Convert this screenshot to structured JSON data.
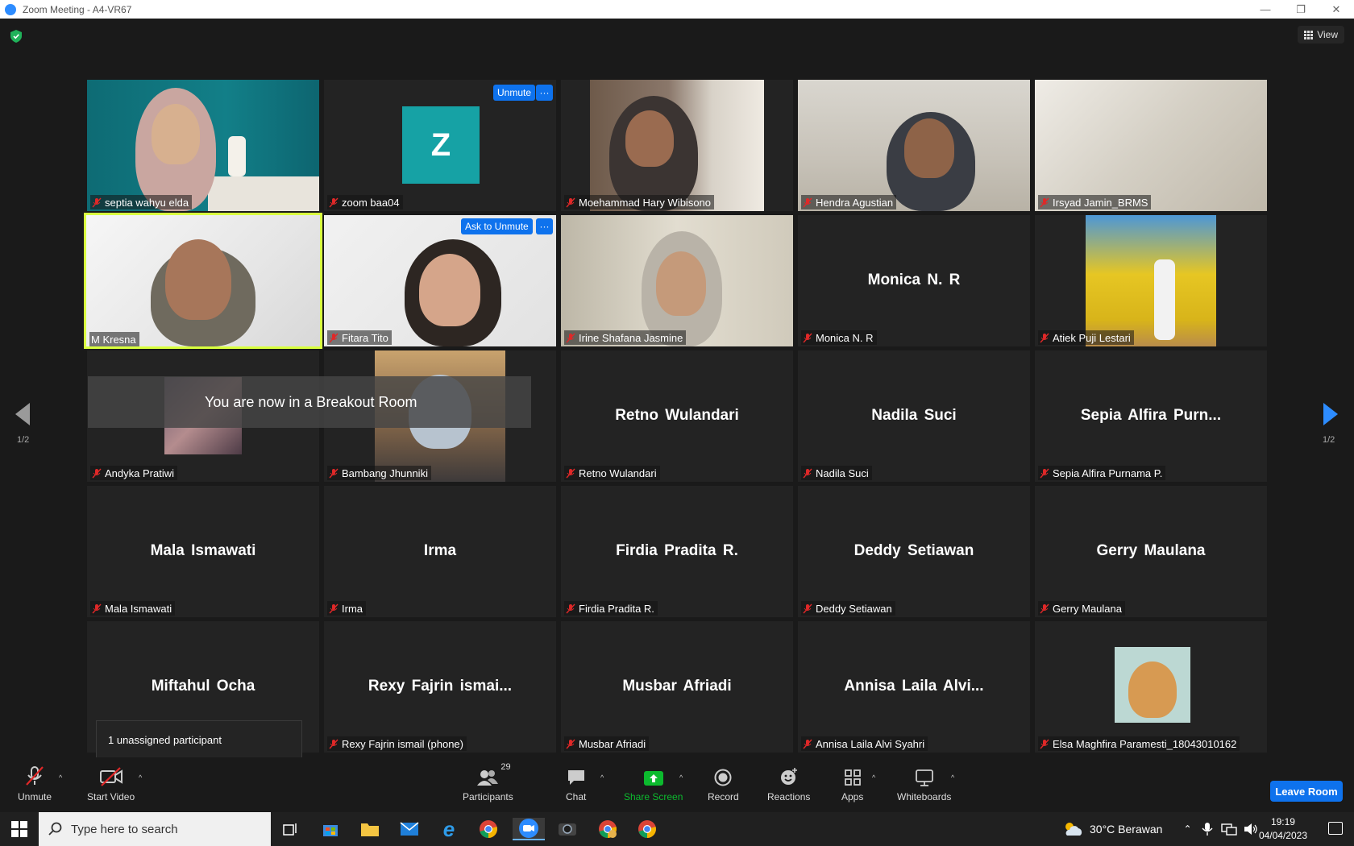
{
  "window": {
    "title": "Zoom Meeting - A4-VR67",
    "minimize": "—",
    "restore": "❐",
    "close": "✕"
  },
  "view": {
    "label": "View"
  },
  "pagination": {
    "left": "1/2",
    "right": "1/2"
  },
  "tiles": [
    {
      "name": "septia wahyu elda",
      "big": ""
    },
    {
      "name": "zoom baa04",
      "big": "",
      "avatar_letter": "Z",
      "tag": "Unmute",
      "more": "···"
    },
    {
      "name": "Moehammad Hary Wibisono",
      "big": ""
    },
    {
      "name": "Hendra Agustian",
      "big": ""
    },
    {
      "name": "Irsyad Jamin_BRMS",
      "big": ""
    },
    {
      "name": "M Kresna",
      "big": ""
    },
    {
      "name": "Fitara Tito",
      "big": "",
      "tag": "Ask to Unmute",
      "more": "···"
    },
    {
      "name": "Irine Shafana Jasmine",
      "big": ""
    },
    {
      "name": "Monica N. R",
      "big": "Monica N. R"
    },
    {
      "name": "Atiek Puji Lestari",
      "big": ""
    },
    {
      "name": "Andyka Pratiwi",
      "big": ""
    },
    {
      "name": "Bambang Jhunniki",
      "big": ""
    },
    {
      "name": "Retno Wulandari",
      "big": "Retno Wulandari"
    },
    {
      "name": "Nadila Suci",
      "big": "Nadila Suci"
    },
    {
      "name": "Sepia Alfira Purnama P.",
      "big": "Sepia Alfira Purn..."
    },
    {
      "name": "Mala Ismawati",
      "big": "Mala Ismawati"
    },
    {
      "name": "Irma",
      "big": "Irma"
    },
    {
      "name": "Firdia Pradita R.",
      "big": "Firdia Pradita R."
    },
    {
      "name": "Deddy Setiawan",
      "big": "Deddy Setiawan"
    },
    {
      "name": "Gerry Maulana",
      "big": "Gerry Maulana"
    },
    {
      "name": "",
      "big": "Miftahul Ocha"
    },
    {
      "name": "Rexy Fajrin ismail (phone)",
      "big": "Rexy Fajrin ismai..."
    },
    {
      "name": "Musbar Afriadi",
      "big": "Musbar Afriadi"
    },
    {
      "name": "Annisa Laila Alvi Syahri",
      "big": "Annisa Laila Alvi..."
    },
    {
      "name": "Elsa Maghfira Paramesti_18043010162",
      "big": ""
    }
  ],
  "breakout_notice": "You are now in a Breakout Room",
  "unassigned_tooltip": "1 unassigned participant",
  "toolbar": {
    "unmute": "Unmute",
    "start_video": "Start Video",
    "participants": "Participants",
    "participants_count": "29",
    "chat": "Chat",
    "share_screen": "Share Screen",
    "record": "Record",
    "reactions": "Reactions",
    "apps": "Apps",
    "whiteboards": "Whiteboards",
    "leave": "Leave Room",
    "caret": "^"
  },
  "taskbar": {
    "search_placeholder": "Type here to search",
    "weather": "30°C Berawan",
    "time": "19:19",
    "date": "04/04/2023"
  },
  "colors": {
    "accent": "#0e72ed",
    "share_green": "#0cba2e",
    "active_speaker": "#d9ff3f",
    "muted_red": "#e02828"
  }
}
